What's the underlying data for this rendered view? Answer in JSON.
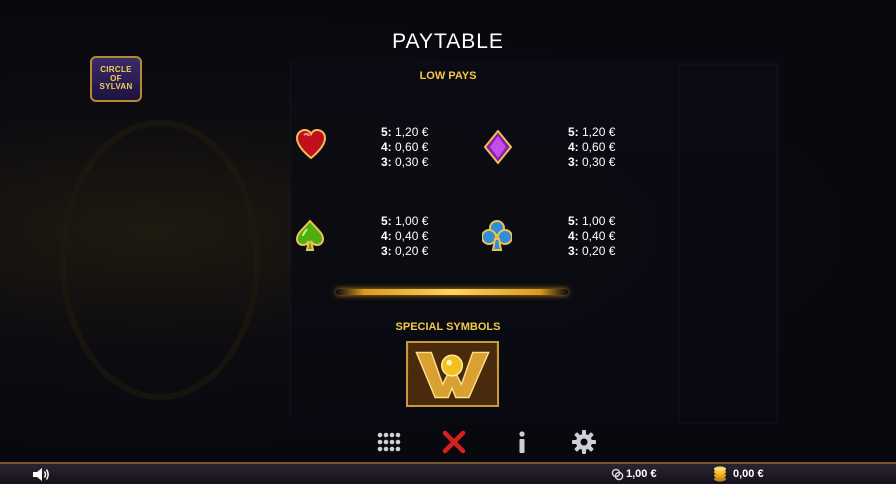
{
  "header": {
    "title": "PAYTABLE"
  },
  "logo": {
    "line1": "CIRCLE",
    "line2": "OF",
    "line3": "SYLVAN"
  },
  "sections": {
    "low_pays": "LOW PAYS",
    "special_symbols": "SPECIAL SYMBOLS"
  },
  "symbols": [
    {
      "name": "heart",
      "color": "#e0202e",
      "pays": [
        "5: 1,20 €",
        "4: 0,60 €",
        "3: 0,30 €"
      ]
    },
    {
      "name": "diamond",
      "color": "#a024c8",
      "pays": [
        "5: 1,20 €",
        "4: 0,60 €",
        "3: 0,30 €"
      ]
    },
    {
      "name": "spade",
      "color": "#6ccf1e",
      "pays": [
        "5: 1,00 €",
        "4: 0,40 €",
        "3: 0,20 €"
      ]
    },
    {
      "name": "club",
      "color": "#3aa6e8",
      "pays": [
        "5: 1,00 €",
        "4: 0,40 €",
        "3: 0,20 €"
      ]
    }
  ],
  "controls": [
    {
      "icon": "grid-menu-icon"
    },
    {
      "icon": "close-icon",
      "color": "#d62020"
    },
    {
      "icon": "info-icon"
    },
    {
      "icon": "gear-icon"
    }
  ],
  "status_bar": {
    "sound_icon": "speaker-icon",
    "bet": "1,00 €",
    "balance": "0,00 €"
  },
  "colors": {
    "accent": "#f2c94c",
    "gold": "#d99a1e"
  }
}
